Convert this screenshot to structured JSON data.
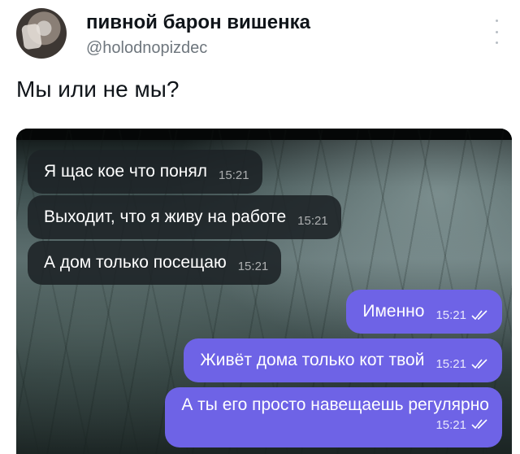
{
  "tweet": {
    "display_name": "пивной барон вишенка",
    "handle": "@holodnopizdec",
    "text": "Мы или не мы?"
  },
  "chat": {
    "incoming": [
      {
        "text": "Я щас кое что понял",
        "time": "15:21"
      },
      {
        "text": "Выходит, что я живу на работе",
        "time": "15:21"
      },
      {
        "text": "А дом только посещаю",
        "time": "15:21"
      }
    ],
    "outgoing": [
      {
        "text": "Именно",
        "time": "15:21",
        "status_icon": "double-check-icon"
      },
      {
        "text": "Живёт дома только кот твой",
        "time": "15:21",
        "status_icon": "double-check-icon"
      },
      {
        "text": "А ты его просто навещаешь регулярно",
        "time": "15:21",
        "status_icon": "double-check-icon"
      }
    ]
  }
}
